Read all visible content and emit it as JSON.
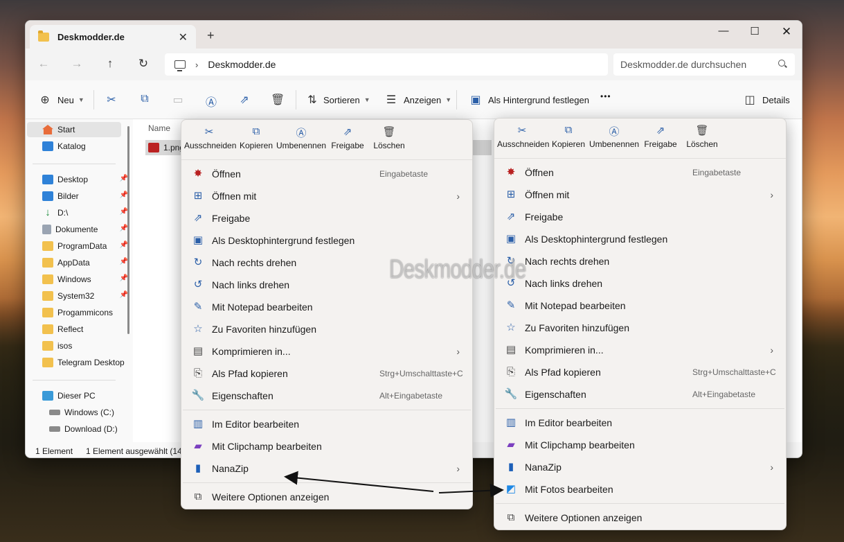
{
  "window": {
    "tab_title": "Deskmodder.de",
    "new_tab_symbol": "+",
    "breadcrumb": "Deskmodder.de",
    "search_placeholder": "Deskmodder.de durchsuchen"
  },
  "toolbar": {
    "new_label": "Neu",
    "sort_label": "Sortieren",
    "view_label": "Anzeigen",
    "wallpaper_label": "Als Hintergrund festlegen",
    "more_symbol": "•••",
    "details_label": "Details"
  },
  "sidebar": {
    "quick": [
      "Start",
      "Katalog"
    ],
    "pinned": [
      "Desktop",
      "Bilder",
      "D:\\",
      "Dokumente",
      "ProgramData",
      "AppData",
      "Windows",
      "System32",
      "Progammicons",
      "Reflect",
      "isos",
      "Telegram Desktop"
    ],
    "pc": [
      "Dieser PC",
      "Windows (C:)",
      "Download (D:)"
    ]
  },
  "content": {
    "column_name": "Name",
    "file_name": "1.png"
  },
  "status": {
    "count": "1 Element",
    "selected": "1 Element ausgewählt (14,"
  },
  "quick_actions": [
    "Ausschneiden",
    "Kopieren",
    "Umbenennen",
    "Freigabe",
    "Löschen"
  ],
  "menu_left": [
    {
      "label": "Öffnen",
      "shortcut": "Eingabetaste",
      "icon": "image-app-icon"
    },
    {
      "label": "Öffnen mit",
      "arrow": true,
      "icon": "open-with-icon"
    },
    {
      "label": "Freigabe",
      "icon": "share-icon"
    },
    {
      "label": "Als Desktophintergrund festlegen",
      "icon": "wallpaper-icon"
    },
    {
      "label": "Nach rechts drehen",
      "icon": "rotate-right-icon"
    },
    {
      "label": "Nach links drehen",
      "icon": "rotate-left-icon"
    },
    {
      "label": "Mit Notepad bearbeiten",
      "icon": "pin-icon"
    },
    {
      "label": "Zu Favoriten hinzufügen",
      "icon": "star-icon"
    },
    {
      "label": "Komprimieren in...",
      "arrow": true,
      "icon": "zip-icon"
    },
    {
      "label": "Als Pfad kopieren",
      "shortcut": "Strg+Umschalttaste+C",
      "icon": "path-icon"
    },
    {
      "label": "Eigenschaften",
      "shortcut": "Alt+Eingabetaste",
      "icon": "wrench-icon"
    },
    {
      "label": "Im Editor bearbeiten",
      "icon": "notepad-icon"
    },
    {
      "label": "Mit Clipchamp bearbeiten",
      "icon": "clipchamp-icon"
    },
    {
      "label": "NanaZip",
      "arrow": true,
      "icon": "nanazip-icon"
    },
    {
      "label": "Weitere Optionen anzeigen",
      "icon": "more-options-icon"
    }
  ],
  "menu_right_extra": {
    "label": "Mit Fotos bearbeiten",
    "icon": "photos-icon"
  },
  "watermark": "Deskmodder.de"
}
